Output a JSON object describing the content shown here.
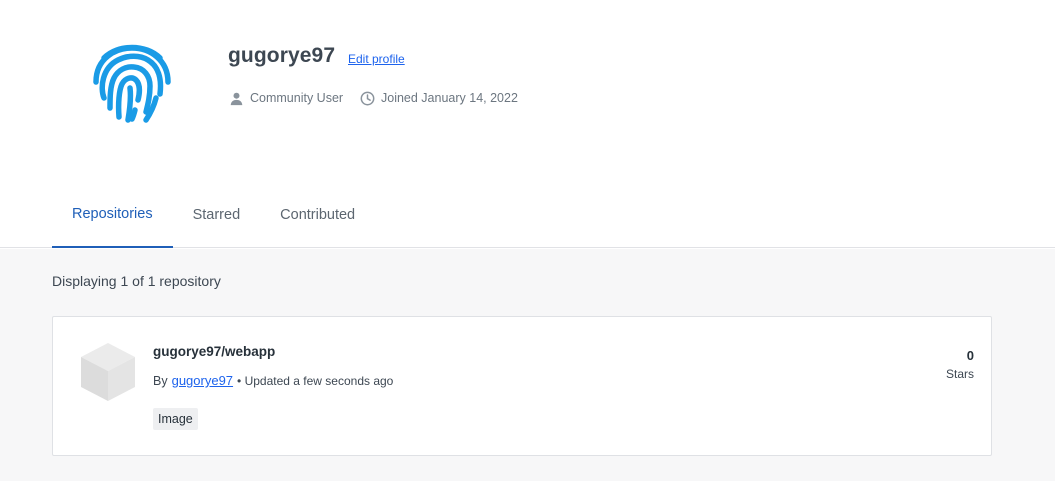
{
  "profile": {
    "username": "gugorye97",
    "edit_label": "Edit profile",
    "role": "Community User",
    "joined": "Joined January 14, 2022",
    "avatar_icon": "fingerprint-icon",
    "avatar_color": "#1a9be6"
  },
  "tabs": [
    {
      "label": "Repositories",
      "active": true
    },
    {
      "label": "Starred",
      "active": false
    },
    {
      "label": "Contributed",
      "active": false
    }
  ],
  "listing": {
    "count_text": "Displaying 1 of 1 repository"
  },
  "repositories": [
    {
      "name": "gugorye97/webapp",
      "by_label": "By",
      "author": "gugorye97",
      "updated": "• Updated a few seconds ago",
      "badge": "Image",
      "stars": "0",
      "stars_label": "Stars",
      "icon": "cube-icon"
    }
  ],
  "colors": {
    "accent": "#1f5fb8",
    "link": "#1d63ed",
    "background": "#f7f7f8"
  }
}
